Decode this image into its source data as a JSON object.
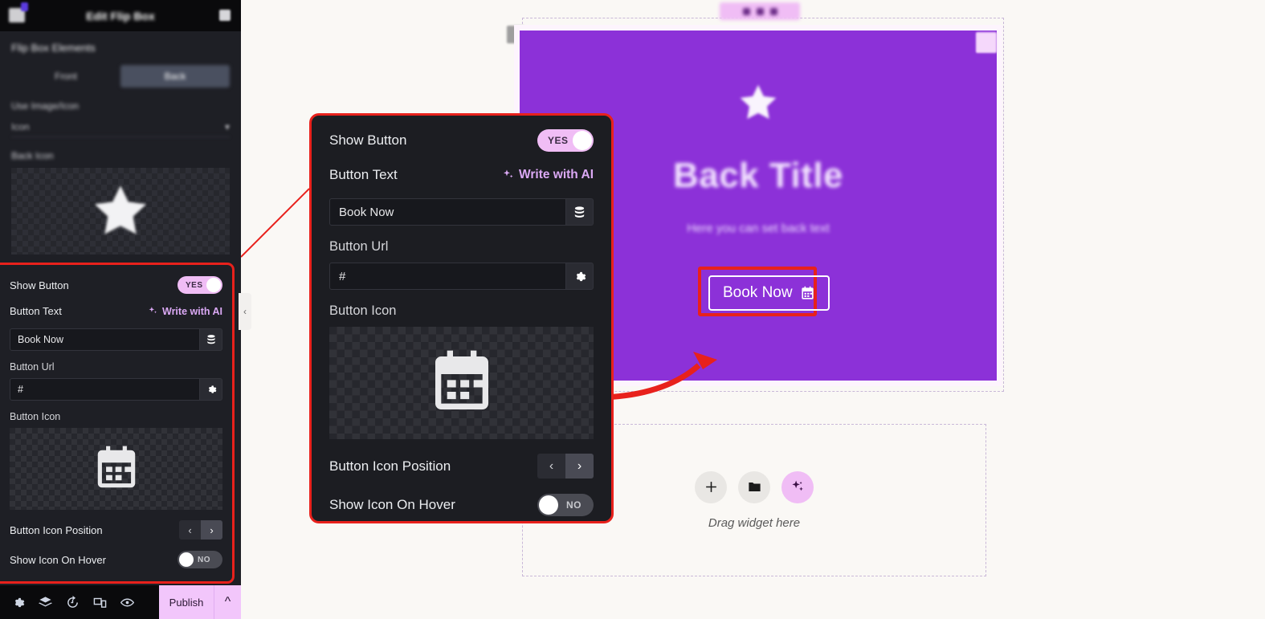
{
  "sidebar": {
    "title": "Edit Flip Box",
    "section_header": "Flip Box Elements",
    "tabs": [
      {
        "label": "Front",
        "active": false
      },
      {
        "label": "Back",
        "active": true
      }
    ],
    "use_image_icon_label": "Use Image/Icon",
    "use_image_icon_value": "Icon",
    "back_icon_label": "Back Icon",
    "back_icon_name": "star-icon"
  },
  "options": {
    "show_button_label": "Show Button",
    "show_button_value": "YES",
    "button_text_label": "Button Text",
    "write_with_ai_label": "Write with AI",
    "button_text_value": "Book Now",
    "button_url_label": "Button Url",
    "button_url_value": "#",
    "button_icon_label": "Button Icon",
    "button_icon_name": "calendar-icon",
    "button_icon_position_label": "Button Icon Position",
    "icon_position_left": "‹",
    "icon_position_right": "›",
    "show_icon_on_hover_label": "Show Icon On Hover",
    "show_icon_on_hover_value": "NO"
  },
  "bottombar": {
    "icons": [
      "gear-icon",
      "layers-icon",
      "history-icon",
      "responsive-icon",
      "preview-icon"
    ],
    "publish_label": "Publish"
  },
  "canvas": {
    "flip_title": "Back Title",
    "flip_subtitle": "Here you can set back text",
    "flip_button_label": "Book Now",
    "flip_button_icon": "calendar-icon",
    "flip_icon": "star-icon",
    "dropzone_label": "Drag widget here",
    "dropzone_buttons": [
      "plus-icon",
      "folder-icon",
      "ai-sparkle-icon"
    ]
  },
  "colors": {
    "flip_bg": "#8c31d8",
    "accent_pink": "#f0bdf5",
    "highlight_red": "#e8211c",
    "ai_purple": "#dba9f5",
    "panel_bg": "#1e1f25"
  }
}
